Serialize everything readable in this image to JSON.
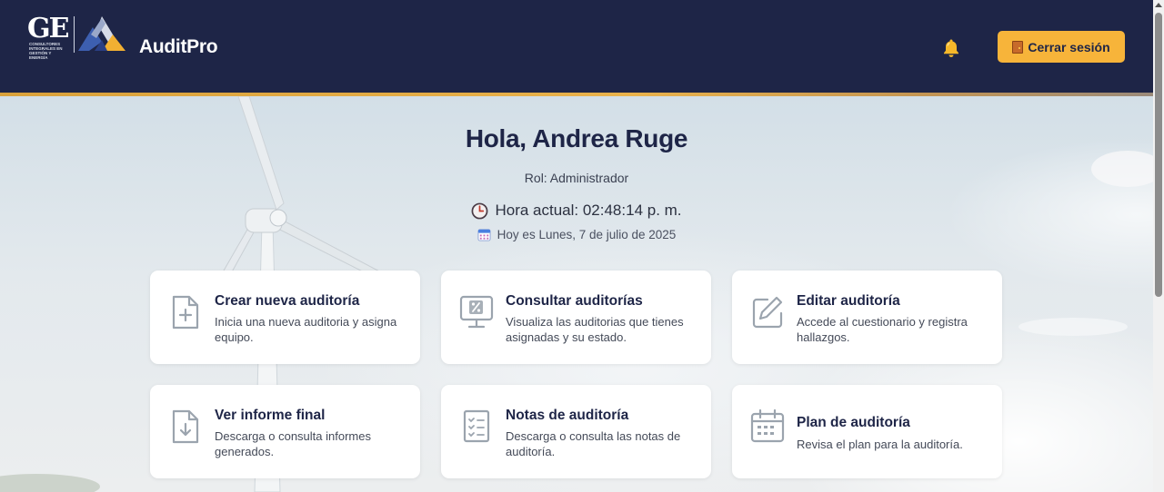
{
  "header": {
    "logo_text": "GE",
    "logo_subtitle": "CONSULTORES INTEGRALES EN GESTIÓN Y ENERGÍA",
    "app_name": "AuditPro",
    "logout_label": "Cerrar sesión",
    "bell_icon": "bell-icon",
    "logout_icon": "door-icon",
    "colors": {
      "header_bg": "#1e2547",
      "accent": "#f7b43a"
    }
  },
  "greeting": {
    "title": "Hola, Andrea Ruge",
    "role": "Rol: Administrador",
    "time": "Hora actual: 02:48:14 p. m.",
    "date": "Hoy es Lunes, 7 de julio de 2025"
  },
  "cards": [
    {
      "title": "Crear nueva auditoría",
      "desc": "Inicia una nueva auditoria y asigna equipo.",
      "icon": "file-plus-icon"
    },
    {
      "title": "Consultar auditorías",
      "desc": "Visualiza las auditorias que tienes asignadas y su estado.",
      "icon": "monitor-icon"
    },
    {
      "title": "Editar auditoría",
      "desc": "Accede al cuestionario y registra hallazgos.",
      "icon": "edit-icon"
    },
    {
      "title": "Ver informe final",
      "desc": "Descarga o consulta informes generados.",
      "icon": "file-download-icon"
    },
    {
      "title": "Notas de auditoría",
      "desc": "Descarga o consulta las notas de auditoría.",
      "icon": "checklist-icon"
    },
    {
      "title": "Plan de auditoría",
      "desc": "Revisa el plan para la auditoría.",
      "icon": "calendar-icon"
    }
  ]
}
